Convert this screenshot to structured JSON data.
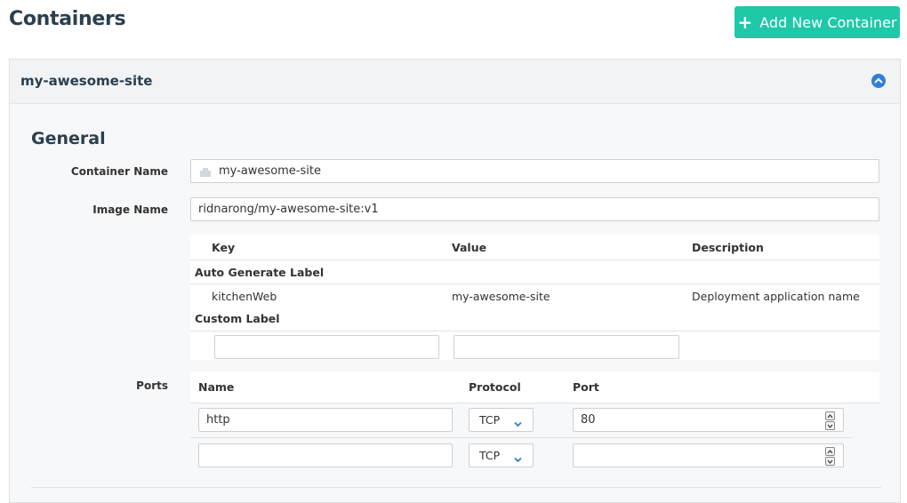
{
  "page": {
    "title": "Containers"
  },
  "header": {
    "add_button_label": "Add New Container",
    "accent": "#1fc8a8"
  },
  "panel": {
    "title": "my-awesome-site",
    "collapse_icon": "chevron-up-circle-icon",
    "section_title": "General",
    "container_name_label": "Container Name",
    "container_name_value": "my-awesome-site",
    "image_name_label": "Image Name",
    "image_name_value": "ridnarong/my-awesome-site:v1",
    "labels_table": {
      "headers": [
        "Key",
        "Value",
        "Description"
      ],
      "auto_group": "Auto Generate Label",
      "auto_rows": [
        {
          "key": "kitchenWeb",
          "value": "my-awesome-site",
          "description": "Deployment application name"
        }
      ],
      "custom_group": "Custom Label",
      "custom_rows": [
        {
          "key": "",
          "value": ""
        }
      ]
    },
    "ports_label": "Ports",
    "ports_table": {
      "headers": [
        "Name",
        "Protocol",
        "Port"
      ],
      "rows": [
        {
          "name": "http",
          "protocol": "TCP",
          "port": "80"
        },
        {
          "name": "",
          "protocol": "TCP",
          "port": ""
        }
      ]
    }
  }
}
